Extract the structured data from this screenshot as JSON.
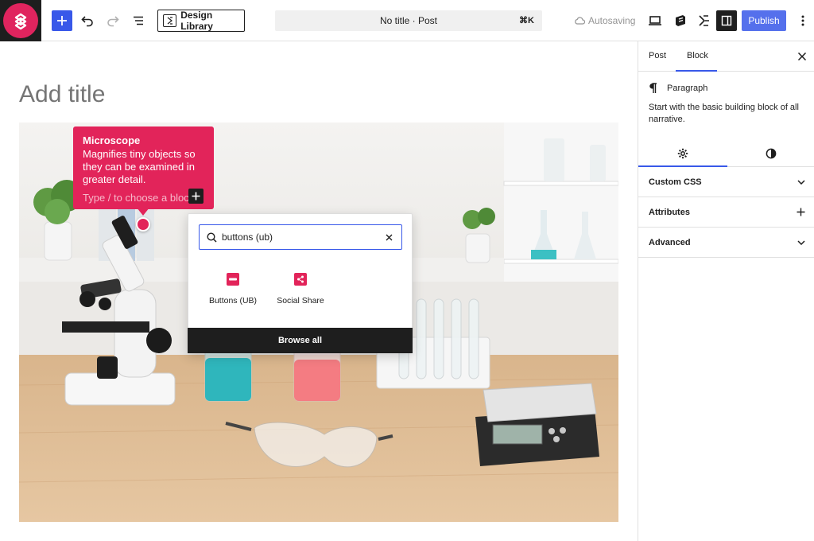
{
  "toolbar": {
    "design_library_label": "Design Library",
    "command_bar_title": "No title · Post",
    "command_shortcut": "⌘K",
    "autosave_label": "Autosaving",
    "publish_label": "Publish"
  },
  "editor": {
    "title_placeholder": "Add title"
  },
  "hotspot_tooltip": {
    "title": "Microscope",
    "description": "Magnifies tiny objects so they can be examined in greater detail.",
    "placeholder": "Type / to choose a block"
  },
  "inserter": {
    "search_value": "buttons (ub)",
    "results": [
      {
        "label": "Buttons (UB)",
        "icon": "minus-icon"
      },
      {
        "label": "Social Share",
        "icon": "share-icon"
      }
    ],
    "browse_all_label": "Browse all"
  },
  "sidebar": {
    "tabs": [
      {
        "label": "Post"
      },
      {
        "label": "Block"
      }
    ],
    "active_tab": "Block",
    "block_name": "Paragraph",
    "block_description": "Start with the basic building block of all narrative.",
    "panels": [
      {
        "label": "Custom CSS",
        "icon": "chevron-down-icon"
      },
      {
        "label": "Attributes",
        "icon": "plus-icon"
      },
      {
        "label": "Advanced",
        "icon": "chevron-down-icon"
      }
    ]
  },
  "colors": {
    "accent": "#3858e9",
    "brand": "#e2245a",
    "dark": "#1e1e1e"
  }
}
